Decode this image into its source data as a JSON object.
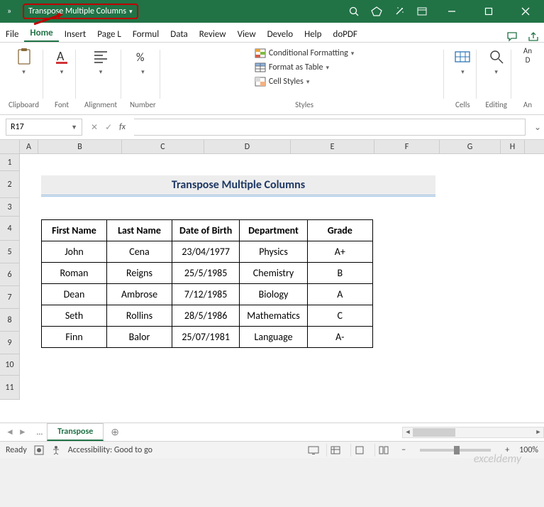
{
  "titlebar": {
    "doc_name": "Transpose Multiple Columns"
  },
  "tabs": {
    "file": "File",
    "home": "Home",
    "insert": "Insert",
    "pagel": "Page L",
    "formul": "Formul",
    "data": "Data",
    "review": "Review",
    "view": "View",
    "develo": "Develo",
    "help": "Help",
    "dopdf": "doPDF"
  },
  "ribbon": {
    "clipboard": "Clipboard",
    "font": "Font",
    "alignment": "Alignment",
    "number": "Number",
    "styles": "Styles",
    "cond_fmt": "Conditional Formatting",
    "fmt_table": "Format as Table",
    "cell_styles": "Cell Styles",
    "cells": "Cells",
    "editing": "Editing",
    "analyze1": "An",
    "analyze2": "D",
    "analyze_lbl": "An"
  },
  "formula_bar": {
    "cell_ref": "R17",
    "fx_label": "fx",
    "value": ""
  },
  "columns": [
    "A",
    "B",
    "C",
    "D",
    "E",
    "F",
    "G",
    "H"
  ],
  "rows": [
    "1",
    "2",
    "3",
    "4",
    "5",
    "6",
    "7",
    "8",
    "9",
    "10",
    "11"
  ],
  "sheet": {
    "title": "Transpose Multiple Columns",
    "headers": [
      "First Name",
      "Last Name",
      "Date of Birth",
      "Department",
      "Grade"
    ],
    "data": [
      [
        "John",
        "Cena",
        "23/04/1977",
        "Physics",
        "A+"
      ],
      [
        "Roman",
        "Reigns",
        "25/5/1985",
        "Chemistry",
        "B"
      ],
      [
        "Dean",
        "Ambrose",
        "7/12/1985",
        "Biology",
        "A"
      ],
      [
        "Seth",
        "Rollins",
        "28/5/1986",
        "Mathematics",
        "C"
      ],
      [
        "Finn",
        "Balor",
        "25/07/1981",
        "Language",
        "A-"
      ]
    ]
  },
  "sheet_tabs": {
    "active": "Transpose"
  },
  "statusbar": {
    "ready": "Ready",
    "access": "Accessibility: Good to go",
    "zoom": "100%"
  },
  "watermark": "exceldemy"
}
